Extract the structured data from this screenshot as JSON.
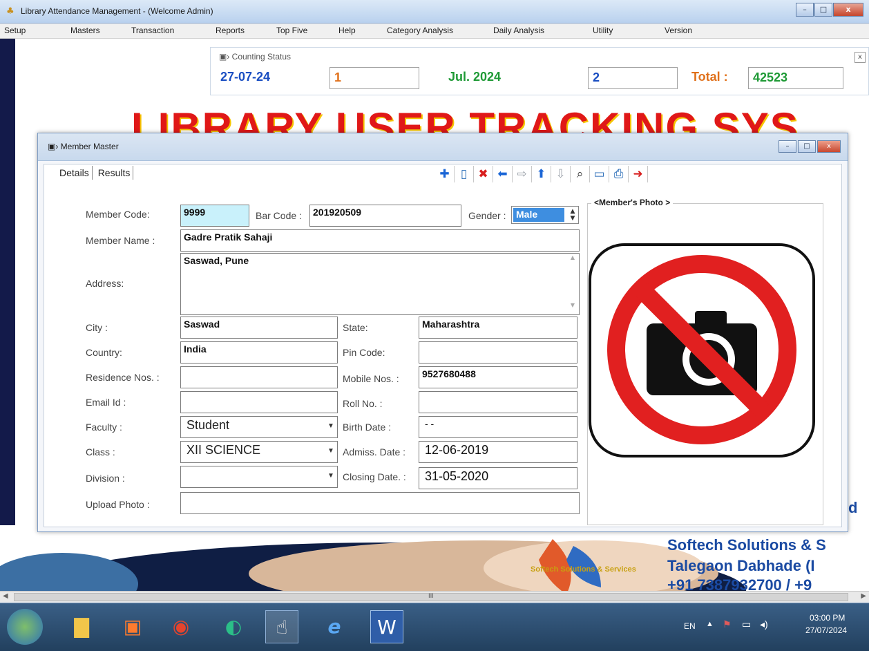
{
  "app": {
    "title": "Library Attendance Management - (Welcome Admin)",
    "window_buttons": {
      "minimize": "–",
      "maximize": "□",
      "close": "x"
    }
  },
  "menu": [
    "Setup",
    "Masters",
    "Transaction",
    "Reports",
    "Top Five",
    "Help",
    "Category Analysis",
    "Daily Analysis",
    "Utility",
    "Version"
  ],
  "counting": {
    "title": "Counting Status",
    "date": "27-07-24",
    "today_count": "1",
    "month": "Jul. 2024",
    "month_count": "2",
    "total_label": "Total :",
    "total_value": "42523",
    "close": "x"
  },
  "banner": {
    "text": "LIBRARY USER TRACKING SYS",
    "side_partial": "d",
    "company_line": "Softech Solutions & S",
    "location": "Talegaon Dabhade (I",
    "phone": "+91 7387932700 / +9",
    "footer_logo": "Softech Solutions & Services"
  },
  "member_master": {
    "title": "Member Master",
    "tabs": [
      "Details",
      "Results"
    ],
    "labels": {
      "member_code": "Member Code:",
      "bar_code": "Bar Code :",
      "gender": "Gender :",
      "member_name": "Member Name :",
      "address": "Address:",
      "city": "City :",
      "state": "State:",
      "country": "Country:",
      "pin_code": "Pin Code:",
      "residence": "Residence Nos. :",
      "mobile": "Mobile Nos. :",
      "email": "Email Id :",
      "roll": "Roll No. :",
      "faculty": "Faculty :",
      "birth_date": "Birth Date :",
      "class": "Class :",
      "admiss_date": "Admiss. Date :",
      "division": "Division :",
      "closing_date": "Closing Date. :",
      "upload_photo": "Upload Photo :",
      "photo_legend": "<Member's Photo >"
    },
    "values": {
      "member_code": "9999",
      "bar_code": "201920509",
      "gender": "Male",
      "member_name": "Gadre Pratik Sahaji",
      "address": "Saswad, Pune",
      "city": "Saswad",
      "state": "Maharashtra",
      "country": "India",
      "pin_code": "",
      "residence": "",
      "mobile": "9527680488",
      "email": "",
      "roll": "",
      "faculty": "Student",
      "birth_date": "- -",
      "class": "XII SCIENCE",
      "admiss_date": "12-06-2019",
      "division": "",
      "closing_date": "31-05-2020",
      "upload_photo": ""
    }
  },
  "taskbar": {
    "lang": "EN",
    "time": "03:00 PM",
    "date": "27/07/2024"
  },
  "scroll_glyph": "III",
  "colors": {
    "accent_blue": "#1a4ec2",
    "banner_red": "#e01818",
    "count_green": "#1f9a36"
  }
}
